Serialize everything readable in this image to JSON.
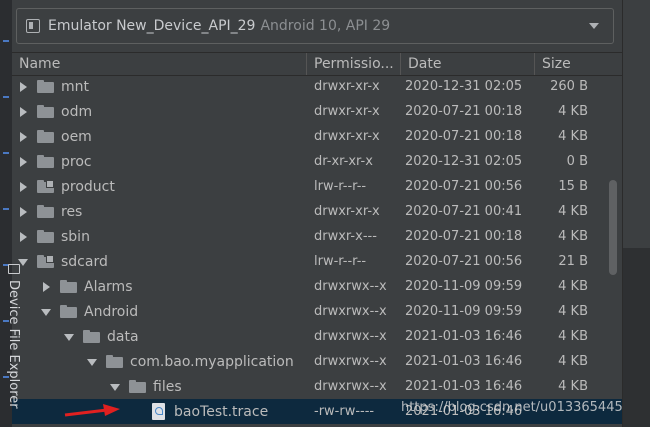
{
  "device_selector": {
    "name": "Emulator New_Device_API_29",
    "api": "Android 10, API 29"
  },
  "columns": {
    "name": "Name",
    "permissions": "Permissio...",
    "date": "Date",
    "size": "Size"
  },
  "rows": [
    {
      "name": "mnt",
      "perm": "drwxr-xr-x",
      "date": "2020-12-31 02:05",
      "size": "260 B",
      "depth": 0,
      "arrow": "right",
      "icon": "folder"
    },
    {
      "name": "odm",
      "perm": "drwxr-xr-x",
      "date": "2020-07-21 00:18",
      "size": "4 KB",
      "depth": 0,
      "arrow": "right",
      "icon": "folder"
    },
    {
      "name": "oem",
      "perm": "drwxr-xr-x",
      "date": "2020-07-21 00:18",
      "size": "4 KB",
      "depth": 0,
      "arrow": "right",
      "icon": "folder"
    },
    {
      "name": "proc",
      "perm": "dr-xr-xr-x",
      "date": "2020-12-31 02:05",
      "size": "0 B",
      "depth": 0,
      "arrow": "right",
      "icon": "folder"
    },
    {
      "name": "product",
      "perm": "lrw-r--r--",
      "date": "2020-07-21 00:56",
      "size": "15 B",
      "depth": 0,
      "arrow": "right",
      "icon": "link-folder"
    },
    {
      "name": "res",
      "perm": "drwxr-xr-x",
      "date": "2020-07-21 00:41",
      "size": "4 KB",
      "depth": 0,
      "arrow": "right",
      "icon": "folder"
    },
    {
      "name": "sbin",
      "perm": "drwxr-x---",
      "date": "2020-07-21 00:18",
      "size": "4 KB",
      "depth": 0,
      "arrow": "right",
      "icon": "folder"
    },
    {
      "name": "sdcard",
      "perm": "lrw-r--r--",
      "date": "2020-07-21 00:56",
      "size": "21 B",
      "depth": 0,
      "arrow": "down",
      "icon": "link-folder"
    },
    {
      "name": "Alarms",
      "perm": "drwxrwx--x",
      "date": "2020-11-09 09:59",
      "size": "4 KB",
      "depth": 1,
      "arrow": "right",
      "icon": "folder"
    },
    {
      "name": "Android",
      "perm": "drwxrwx--x",
      "date": "2020-11-09 09:59",
      "size": "4 KB",
      "depth": 1,
      "arrow": "down",
      "icon": "folder"
    },
    {
      "name": "data",
      "perm": "drwxrwx--x",
      "date": "2021-01-03 16:46",
      "size": "4 KB",
      "depth": 2,
      "arrow": "down",
      "icon": "folder"
    },
    {
      "name": "com.bao.myapplication",
      "perm": "drwxrwx--x",
      "date": "2021-01-03 16:46",
      "size": "4 KB",
      "depth": 3,
      "arrow": "down",
      "icon": "folder"
    },
    {
      "name": "files",
      "perm": "drwxrwx--x",
      "date": "2021-01-03 16:46",
      "size": "4 KB",
      "depth": 4,
      "arrow": "down",
      "icon": "folder"
    },
    {
      "name": "baoTest.trace",
      "perm": "-rw-rw----",
      "date": "2021-01-03 16:46",
      "size": "",
      "depth": 5,
      "arrow": "none",
      "icon": "file",
      "selected": true
    }
  ],
  "watermark": "https://blog.csdn.net/u013365445",
  "tool_window": {
    "label": "Device File Explorer"
  },
  "colors": {
    "background": "#3c3f41",
    "selection": "#0d293e",
    "annotation_arrow": "#e02020"
  }
}
